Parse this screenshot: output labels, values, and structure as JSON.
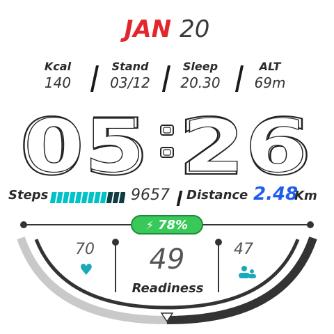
{
  "date": {
    "month": "JAN",
    "day": "20"
  },
  "stats": [
    {
      "label": "Kcal",
      "value": "140"
    },
    {
      "label": "Stand",
      "value": "03/12"
    },
    {
      "label": "Sleep",
      "value": "20.30"
    },
    {
      "label": "ALT",
      "value": "69m"
    }
  ],
  "time": {
    "hours": "05",
    "minutes": "26"
  },
  "steps": {
    "label": "Steps",
    "value": "9657",
    "progress": 0.75
  },
  "distance": {
    "label": "Distance",
    "value": "2.48",
    "unit": "Km"
  },
  "battery": {
    "value": "78%",
    "icon": "bolt-icon"
  },
  "heart_rate": {
    "value": "70",
    "icon": "heart-icon"
  },
  "readiness": {
    "value": "49",
    "label": "Readiness"
  },
  "people": {
    "value": "47",
    "icon": "people-icon"
  },
  "colors": {
    "accent_red": "#e3262b",
    "steps_cyan": "#00c2c7",
    "distance_blue": "#1f5cf0",
    "battery_green": "#38c95a",
    "icon_teal": "#1aa9b8"
  }
}
